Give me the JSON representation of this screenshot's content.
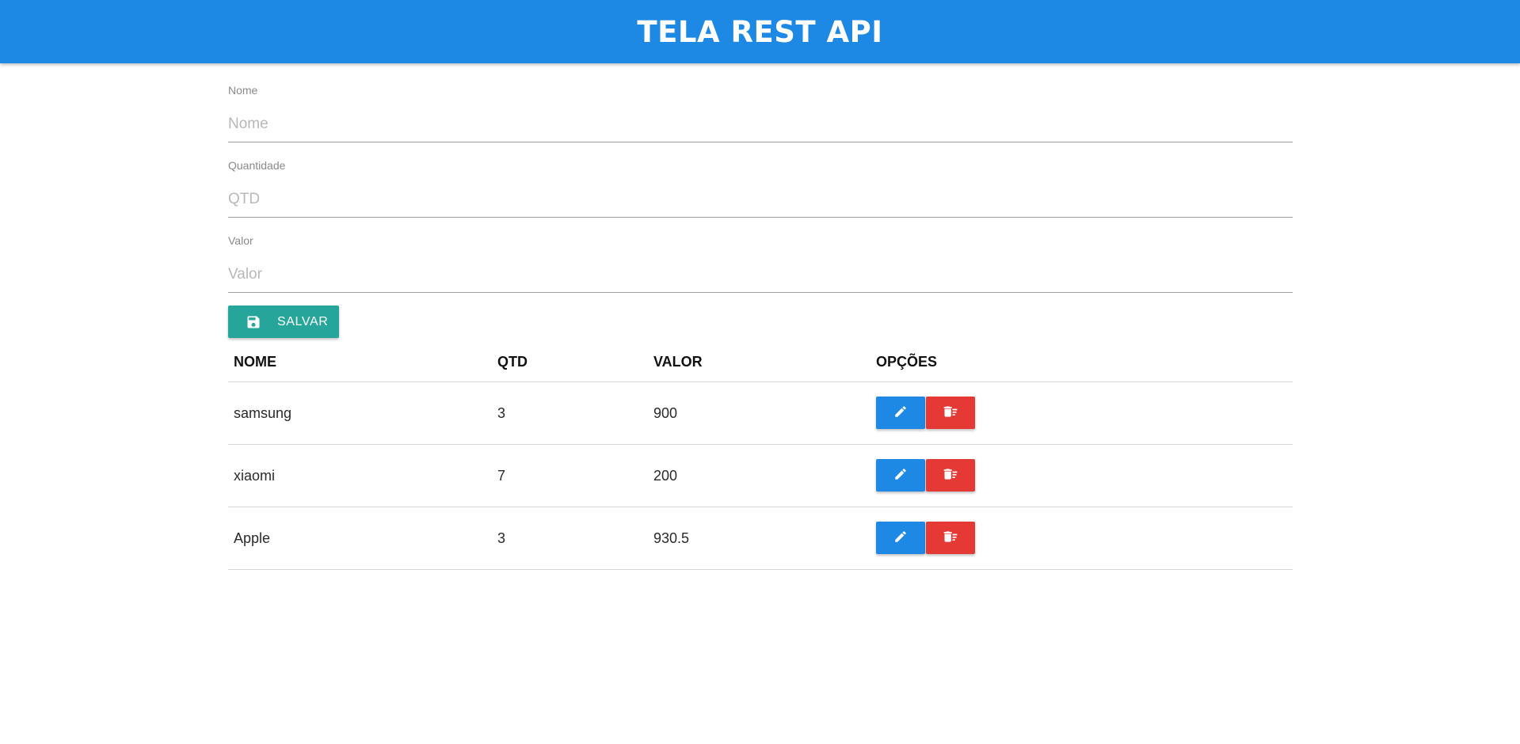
{
  "header": {
    "title": "TELA REST API"
  },
  "form": {
    "fields": [
      {
        "label": "Nome",
        "placeholder": "Nome",
        "value": ""
      },
      {
        "label": "Quantidade",
        "placeholder": "QTD",
        "value": ""
      },
      {
        "label": "Valor",
        "placeholder": "Valor",
        "value": ""
      }
    ],
    "save_label": "SALVAR",
    "save_icon": "save-icon"
  },
  "table": {
    "headers": {
      "nome": "NOME",
      "qtd": "QTD",
      "valor": "VALOR",
      "opcoes": "OPÇÕES"
    },
    "rows": [
      {
        "nome": "samsung",
        "qtd": "3",
        "valor": "900"
      },
      {
        "nome": "xiaomi",
        "qtd": "7",
        "valor": "200"
      },
      {
        "nome": "Apple",
        "qtd": "3",
        "valor": "930.5"
      }
    ],
    "edit_icon": "pencil-icon",
    "delete_icon": "delete-sweep-icon"
  },
  "colors": {
    "header": "#1e88e5",
    "save_button": "#26a69a",
    "edit_button": "#1e88e5",
    "delete_button": "#e53935"
  }
}
